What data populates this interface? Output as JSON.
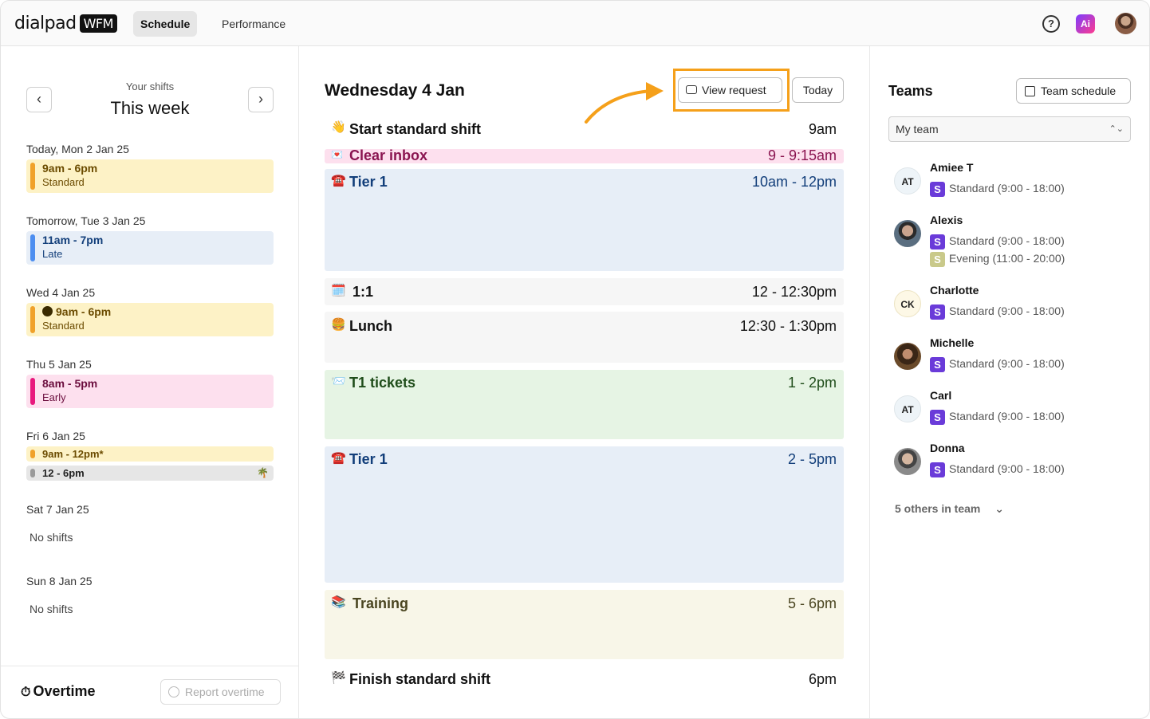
{
  "header": {
    "logo_text": "dialpad",
    "logo_badge": "WFM",
    "tabs": [
      {
        "label": "Schedule",
        "active": true
      },
      {
        "label": "Performance",
        "active": false
      }
    ],
    "help_glyph": "?",
    "ai_glyph": "Ai"
  },
  "left": {
    "caption": "Your shifts",
    "title": "This week",
    "prev_glyph": "‹",
    "next_glyph": "›",
    "days": [
      {
        "label": "Today, Mon 2 Jan 25",
        "time": "9am - 6pm",
        "type": "Standard"
      },
      {
        "label": "Tomorrow, Tue 3 Jan 25",
        "time": "11am - 7pm",
        "type": "Late"
      },
      {
        "label": "Wed 4 Jan 25",
        "time": "9am - 6pm",
        "type": "Standard"
      },
      {
        "label": "Thu 5 Jan 25",
        "time": "8am - 5pm",
        "type": "Early"
      },
      {
        "label": "Fri 6 Jan 25",
        "time_a": "9am - 12pm*",
        "time_b": "12 - 6pm"
      },
      {
        "label": "Sat 7 Jan 25",
        "empty": "No shifts"
      },
      {
        "label": "Sun 8 Jan 25",
        "empty": "No shifts"
      }
    ],
    "overtime_title": "Overtime",
    "report_label": "Report overtime",
    "colors": {
      "standard_bg": "#fdf2c6",
      "standard_bar": "#f0a12a",
      "late_bg": "#e7eef7",
      "late_bar": "#4d8ef0",
      "early_bg": "#fde0ee",
      "early_bar": "#e8197d",
      "off_bg": "#e6e6e6",
      "off_bar": "#9a9a9a"
    }
  },
  "mid": {
    "day_title": "Wednesday 4 Jan",
    "view_request_label": "View request",
    "today_label": "Today",
    "events": [
      {
        "icon": "👋",
        "name": "Start standard shift",
        "time": "9am"
      },
      {
        "icon": "💌",
        "name": "Clear inbox",
        "time": "9 - 9:15am"
      },
      {
        "icon": "☎️",
        "name": "Tier 1",
        "time": "10am - 12pm"
      },
      {
        "icon": "🗓️",
        "name": "1:1",
        "time": "12 - 12:30pm"
      },
      {
        "icon": "🍔",
        "name": "Lunch",
        "time": "12:30 - 1:30pm"
      },
      {
        "icon": "📨",
        "name": "T1 tickets",
        "time": "1 - 2pm"
      },
      {
        "icon": "☎️",
        "name": "Tier 1",
        "time": "2 - 5pm"
      },
      {
        "icon": "📚",
        "name": "Training",
        "time": "5 - 6pm"
      },
      {
        "icon": "🏁",
        "name": "Finish standard shift",
        "time": "6pm"
      }
    ],
    "colors": {
      "inbox_bg": "#fde0ee",
      "inbox_text": "#8a1450",
      "tier_bg": "#e7eef7",
      "tier_text": "#123e7a",
      "neutral_bg": "#f6f6f6",
      "tickets_bg": "#e6f4e4",
      "tickets_text": "#1f4d1a",
      "training_bg": "#f8f6e8",
      "training_text": "#4a4520",
      "highlight": "#f5a01a"
    }
  },
  "right": {
    "title": "Teams",
    "team_schedule_label": "Team schedule",
    "select_value": "My team",
    "select_glyph": "⌃⌄",
    "members": [
      {
        "initials": "AT",
        "name": "Amiee T",
        "shifts": [
          {
            "badge": "S",
            "text": "Standard (9:00 - 18:00)"
          }
        ]
      },
      {
        "initials": "",
        "name": "Alexis",
        "shifts": [
          {
            "badge": "S",
            "text": "Standard (9:00 - 18:00)"
          },
          {
            "badge": "S",
            "text": "Evening (11:00 - 20:00)"
          }
        ]
      },
      {
        "initials": "CK",
        "name": "Charlotte",
        "shifts": [
          {
            "badge": "S",
            "text": "Standard (9:00 - 18:00)"
          }
        ]
      },
      {
        "initials": "",
        "name": "Michelle",
        "shifts": [
          {
            "badge": "S",
            "text": "Standard (9:00 - 18:00)"
          }
        ]
      },
      {
        "initials": "AT",
        "name": "Carl",
        "shifts": [
          {
            "badge": "S",
            "text": "Standard (9:00 - 18:00)"
          }
        ]
      },
      {
        "initials": "",
        "name": "Donna",
        "shifts": [
          {
            "badge": "S",
            "text": "Standard (9:00 - 18:00)"
          }
        ]
      }
    ],
    "others_label": "5 others in team",
    "others_glyph": "⌄",
    "colors": {
      "standard_badge": "#6a3bd9",
      "evening_badge": "#c9c98a"
    }
  }
}
